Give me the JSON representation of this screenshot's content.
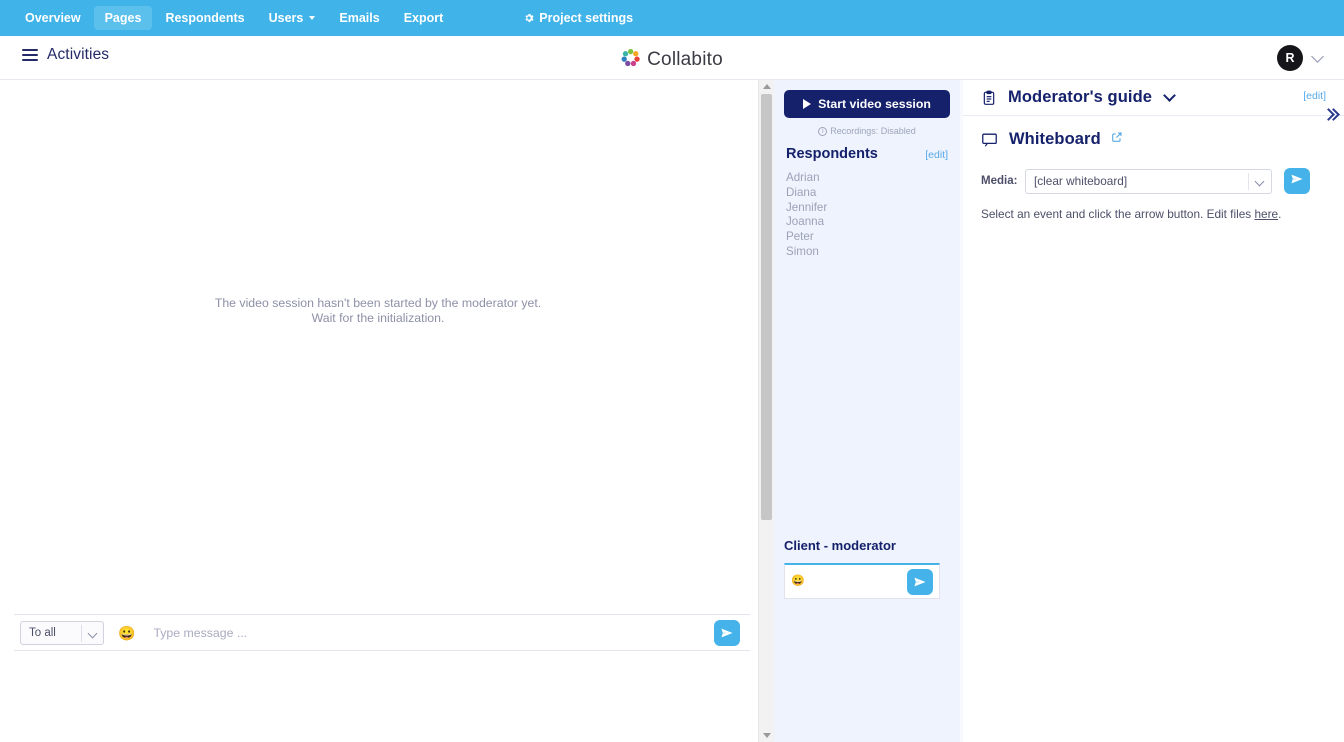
{
  "topnav": {
    "items": [
      {
        "label": "Overview",
        "active": false,
        "dropdown": false
      },
      {
        "label": "Pages",
        "active": true,
        "dropdown": false
      },
      {
        "label": "Respondents",
        "active": false,
        "dropdown": false
      },
      {
        "label": "Users",
        "active": false,
        "dropdown": true
      },
      {
        "label": "Emails",
        "active": false,
        "dropdown": false
      },
      {
        "label": "Export",
        "active": false,
        "dropdown": false
      }
    ],
    "settings_label": "Project settings",
    "settings_icon": "gear-icon",
    "background_color": "#40b3e8",
    "active_pill_color": "#5cc0ed"
  },
  "header": {
    "menu_icon": "hamburger-icon",
    "activities_label": "Activities",
    "brand_name": "Collabito",
    "brand_icon": "collabito-logo-icon",
    "avatar_initial": "R",
    "avatar_caret_icon": "chevron-down-icon"
  },
  "video": {
    "message_line1": "The video session hasn't been started by the moderator yet.",
    "message_line2": "Wait for the initialization."
  },
  "chatbar": {
    "recipient_value": "To all",
    "recipient_caret_icon": "chevron-down-icon",
    "emoji_icon": "smiley-icon",
    "input_placeholder": "Type message ...",
    "input_value": "",
    "send_icon": "send-paper-plane-icon"
  },
  "scrollbar": {
    "up_icon": "scroll-up-arrow-icon",
    "down_icon": "scroll-down-arrow-icon",
    "thumb": "scrollbar-thumb"
  },
  "session": {
    "start_button_label": "Start video session",
    "start_button_icon": "play-icon",
    "start_button_color": "#15216b",
    "recordings_status": "Recordings: Disabled",
    "recordings_icon": "info-icon",
    "respondents_title": "Respondents",
    "respondents_edit_label": "[edit]",
    "respondents": [
      "Adrian",
      "Diana",
      "Jennifer",
      "Joanna",
      "Peter",
      "Simon"
    ],
    "client_moderator_title": "Client - moderator",
    "client_emoji_icon": "smiley-icon",
    "client_input_value": "",
    "client_send_icon": "send-paper-plane-icon"
  },
  "guide": {
    "moderator_guide_title": "Moderator's guide",
    "moderator_guide_icon": "clipboard-icon",
    "moderator_guide_chevron_icon": "chevron-down-icon",
    "moderator_guide_edit_label": "[edit]",
    "whiteboard_title": "Whiteboard",
    "whiteboard_icon": "whiteboard-icon",
    "whiteboard_external_icon": "external-link-icon",
    "media_label": "Media:",
    "media_value": "[clear whiteboard]",
    "media_caret_icon": "chevron-down-icon",
    "media_send_icon": "send-paper-plane-icon",
    "hint_prefix": "Select an event and click the arrow button. Edit files ",
    "hint_link": "here",
    "hint_suffix": "."
  },
  "collapse": {
    "icon": "double-chevron-right-icon"
  }
}
